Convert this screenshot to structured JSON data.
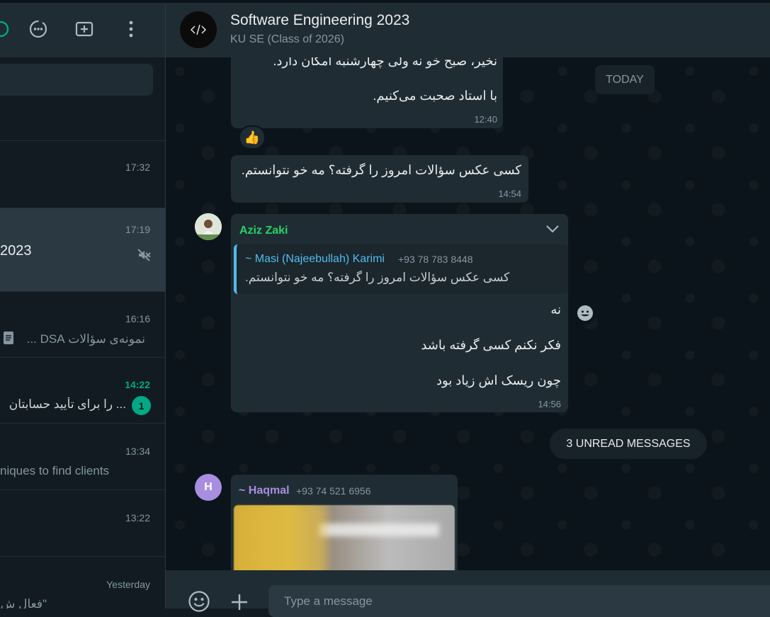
{
  "header": {
    "title": "Software Engineering 2023",
    "subtitle": "KU SE (Class of 2026)"
  },
  "left_header_icons": [
    "communities-icon",
    "status-icon",
    "channels-icon",
    "new-chat-icon",
    "menu-icon"
  ],
  "chats": [
    {
      "time": "17:32",
      "name": "",
      "preview": ""
    },
    {
      "time": "17:19",
      "name": "2023",
      "preview": "",
      "muted": true,
      "active": true
    },
    {
      "time": "16:16",
      "name": "",
      "preview": "نمونه‌ی سؤالات DSA ..."
    },
    {
      "time": "14:22",
      "name": "",
      "preview": "... را برای تأیید حسابتان",
      "unread_count": "1"
    },
    {
      "time": "13:34",
      "name": "",
      "preview": "niques to find clients"
    },
    {
      "time": "13:22",
      "name": "",
      "preview": ""
    },
    {
      "time": "Yesterday",
      "name": "",
      "preview": "\"فعال ش"
    }
  ],
  "messages": {
    "today_label": "TODAY",
    "m1": {
      "line1": "نخیر، صبح خو نه ولی چهارشنبه امکان دارد.",
      "line2": "با استاد صحبت می‌کنیم.",
      "time": "12:40",
      "reaction": "👍"
    },
    "m2": {
      "text": "کسی عکس سؤالات امروز را گرفته؟ مه خو نتوانستم.",
      "time": "14:54"
    },
    "m3": {
      "sender": "Aziz Zaki",
      "quote_sender": "~ Masi (Najeebullah) Karimi",
      "quote_phone": "+93 78 783 8448",
      "quote_text": "کسی عکس سؤالات امروز را گرفته؟ مه خو نتوانستم.",
      "line1": "نه",
      "line2": "فکر نکنم کسی گرفته باشد",
      "line3": "چون ریسک اش زیاد بود",
      "time": "14:56"
    },
    "unread_label": "3 UNREAD MESSAGES",
    "m4": {
      "avatar_letter": "H",
      "sender": "~ Haqmal",
      "phone": "+93 74 521 6956"
    }
  },
  "footer": {
    "placeholder": "Type a message"
  },
  "colors": {
    "accent": "#00a884",
    "bubble": "#202c33",
    "background": "#0b141a",
    "aziz_name": "#25d366",
    "masi_name": "#53bdeb",
    "haqmal_name": "#a88ee0"
  }
}
